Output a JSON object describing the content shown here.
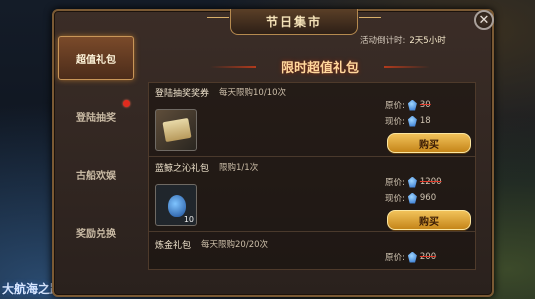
{
  "window": {
    "title": "节日集市",
    "close_icon": "close-icon"
  },
  "countdown": {
    "label": "活动倒计时:",
    "value": "2天5小时"
  },
  "banner": {
    "title": "限时超值礼包"
  },
  "tabs": [
    {
      "label": "超值礼包",
      "active": true
    },
    {
      "label": "登陆抽奖",
      "badge": true
    },
    {
      "label": "古船欢娱"
    },
    {
      "label": "奖励兑换"
    }
  ],
  "items": [
    {
      "name": "登陆抽奖奖券",
      "limit": "每天限购10/10次",
      "original_label": "原价:",
      "original_price": "30",
      "current_label": "现价:",
      "current_price": "18",
      "buy_label": "购买",
      "icon": "ticket-scroll-icon",
      "qty": ""
    },
    {
      "name": "蓝鲸之沁礼包",
      "limit": "限购1/1次",
      "original_label": "原价:",
      "original_price": "1200",
      "current_label": "现价:",
      "current_price": "960",
      "buy_label": "购买",
      "icon": "potion-icon",
      "qty": "10"
    },
    {
      "name": "炼金礼包",
      "limit": "每天限购20/20次",
      "original_label": "原价:",
      "original_price": "200"
    }
  ],
  "game_logo": "大航海之路",
  "colors": {
    "accent_gold": "#f1c25a",
    "active_tab": "#7a4a2a",
    "gem_blue": "#2469c9",
    "badge_red": "#e02b1e"
  }
}
